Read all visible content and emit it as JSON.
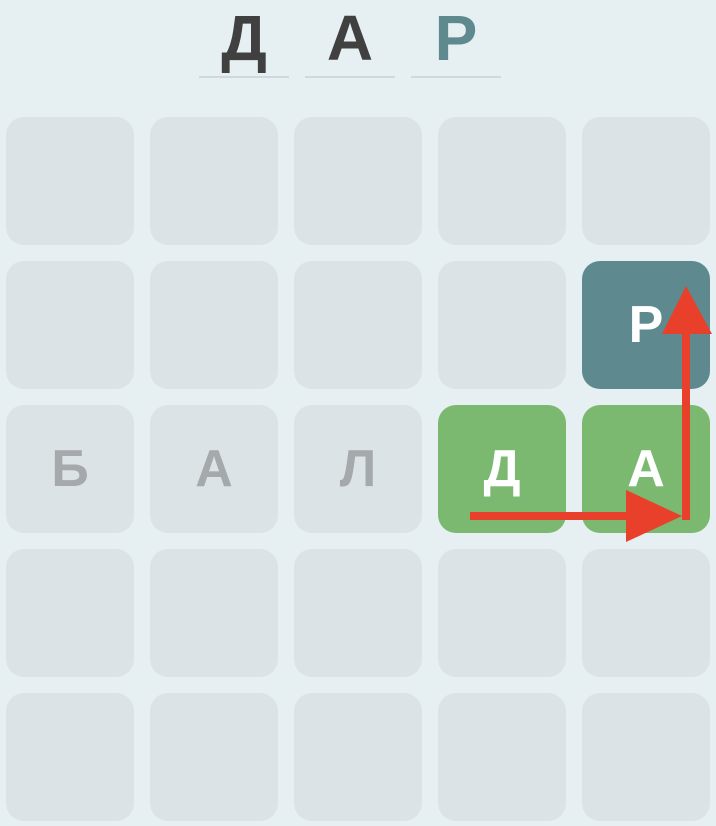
{
  "target_word": {
    "letters": [
      {
        "char": "Д",
        "state": "filled"
      },
      {
        "char": "А",
        "state": "filled"
      },
      {
        "char": "Р",
        "state": "new"
      }
    ]
  },
  "board": {
    "rows": [
      [
        "",
        "",
        "",
        "",
        ""
      ],
      [
        "",
        "",
        "",
        "",
        "Р"
      ],
      [
        "Б",
        "А",
        "Л",
        "Д",
        "А"
      ],
      [
        "",
        "",
        "",
        "",
        ""
      ],
      [
        "",
        "",
        "",
        "",
        ""
      ]
    ],
    "states": [
      [
        "empty",
        "empty",
        "empty",
        "empty",
        "empty"
      ],
      [
        "empty",
        "empty",
        "empty",
        "empty",
        "new"
      ],
      [
        "letter",
        "letter",
        "letter",
        "selected",
        "selected"
      ],
      [
        "empty",
        "empty",
        "empty",
        "empty",
        "empty"
      ],
      [
        "empty",
        "empty",
        "empty",
        "empty",
        "empty"
      ]
    ]
  },
  "colors": {
    "selected": "#7bb870",
    "new": "#5e8a8f",
    "arrow": "#e8402a"
  }
}
